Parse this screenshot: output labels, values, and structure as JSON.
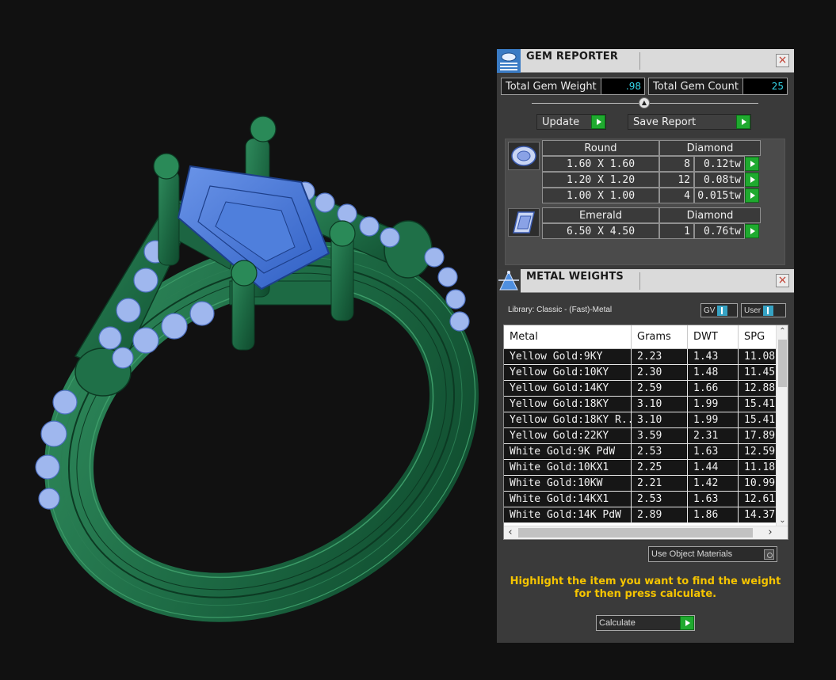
{
  "gem_reporter": {
    "title": "GEM REPORTER",
    "close_label": "×",
    "total_weight_label": "Total Gem Weight",
    "total_weight_value": ".98",
    "total_count_label": "Total Gem Count",
    "total_count_value": "25",
    "update_label": "Update",
    "save_report_label": "Save Report",
    "groups": [
      {
        "icon": "round-gem-icon",
        "shape": "Round",
        "material": "Diamond",
        "rows": [
          {
            "size": "1.60 X 1.60",
            "count": "8",
            "weight": "0.12tw"
          },
          {
            "size": "1.20 X 1.20",
            "count": "12",
            "weight": "0.08tw"
          },
          {
            "size": "1.00 X 1.00",
            "count": "4",
            "weight": "0.015tw"
          }
        ]
      },
      {
        "icon": "emerald-gem-icon",
        "shape": "Emerald",
        "material": "Diamond",
        "rows": [
          {
            "size": "6.50 X 4.50",
            "count": "1",
            "weight": "0.76tw"
          }
        ]
      }
    ]
  },
  "metal_weights": {
    "title": "METAL WEIGHTS",
    "close_label": "×",
    "library_label": "Library: Classic - (Fast)-Metal",
    "gv_label": "GV",
    "user_label": "User",
    "columns": [
      "Metal",
      "Grams",
      "DWT",
      "SPG"
    ],
    "rows": [
      [
        "Yellow Gold:9KY",
        "2.23",
        "1.43",
        "11.08"
      ],
      [
        "Yellow Gold:10KY",
        "2.30",
        "1.48",
        "11.45"
      ],
      [
        "Yellow Gold:14KY",
        "2.59",
        "1.66",
        "12.88"
      ],
      [
        "Yellow Gold:18KY",
        "3.10",
        "1.99",
        "15.41"
      ],
      [
        "Yellow Gold:18KY R...",
        "3.10",
        "1.99",
        "15.41"
      ],
      [
        "Yellow Gold:22KY",
        "3.59",
        "2.31",
        "17.89"
      ],
      [
        "White Gold:9K PdW",
        "2.53",
        "1.63",
        "12.59"
      ],
      [
        "White Gold:10KX1",
        "2.25",
        "1.44",
        "11.18"
      ],
      [
        "White Gold:10KW",
        "2.21",
        "1.42",
        "10.99"
      ],
      [
        "White Gold:14KX1",
        "2.53",
        "1.63",
        "12.61"
      ],
      [
        "White Gold:14K PdW",
        "2.89",
        "1.86",
        "14.37"
      ]
    ],
    "use_object_materials_label": "Use Object Materials",
    "hint_line1": "Highlight the item you want to find the weight",
    "hint_line2": "for then press calculate.",
    "calculate_label": "Calculate"
  },
  "colors": {
    "metal_green": "#1e6b45",
    "center_stone_blue": "#3a6fd1",
    "side_stone_blue": "#9fb7ee",
    "accent_green_button": "#1faa2f",
    "value_cyan": "#36d7ea",
    "hint_yellow": "#f5c400"
  }
}
